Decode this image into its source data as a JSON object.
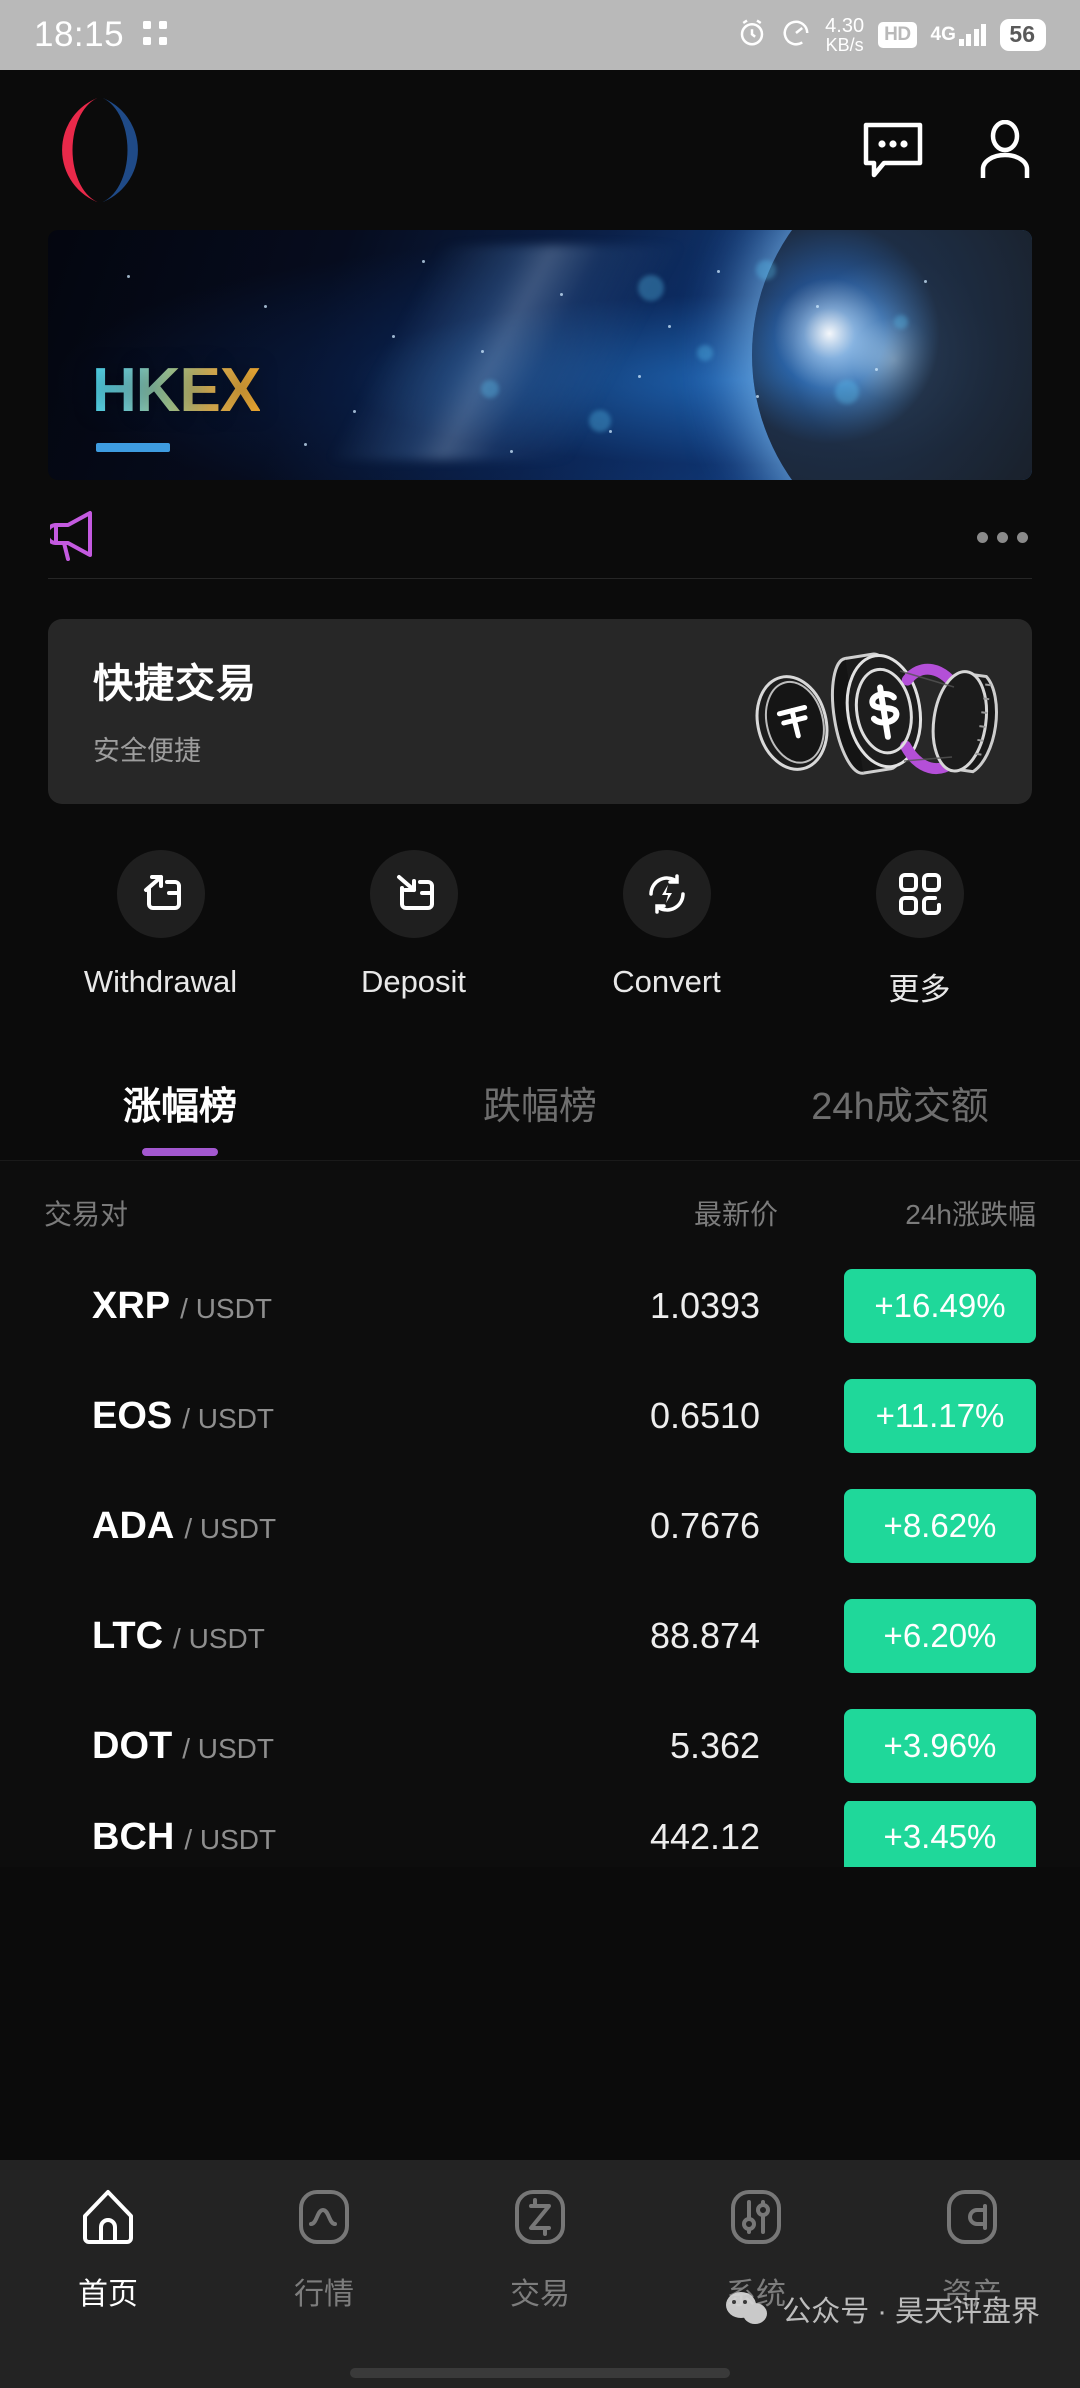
{
  "status_bar": {
    "time": "18:15",
    "network_speed_value": "4.30",
    "network_speed_unit": "KB/s",
    "hd_label": "HD",
    "network_type": "4G",
    "battery": "56",
    "icons": [
      "alarm-clock-icon",
      "speedometer-icon",
      "hd-icon",
      "signal-bars-icon",
      "battery-icon"
    ]
  },
  "header": {
    "logo_name": "hkex-logo",
    "logo_red": "#e9294a",
    "logo_blue": "#1f4a87",
    "chat_icon": "chat-bubble-icon",
    "profile_icon": "person-icon"
  },
  "banner": {
    "title": "HKEX",
    "gradient_start": "#4ad6ef",
    "gradient_end": "#f2a92e",
    "underline_color": "#3e9ce0"
  },
  "announcement": {
    "megaphone_icon": "megaphone-icon",
    "megaphone_color": "#c45ae0",
    "more_icon": "more-dots-icon"
  },
  "quick_trade": {
    "title": "快捷交易",
    "subtitle": "安全便捷",
    "illustration": "three-coins-icon",
    "accent": "#a358d0"
  },
  "actions": [
    {
      "label": "Withdrawal",
      "icon": "withdraw-arrow-out-icon"
    },
    {
      "label": "Deposit",
      "icon": "deposit-arrow-in-icon"
    },
    {
      "label": "Convert",
      "icon": "convert-refresh-icon"
    },
    {
      "label": "更多",
      "icon": "grid-more-icon"
    }
  ],
  "market_tabs": [
    {
      "label": "涨幅榜",
      "active": true
    },
    {
      "label": "跌幅榜",
      "active": false
    },
    {
      "label": "24h成交额",
      "active": false
    }
  ],
  "market_table": {
    "columns": [
      "交易对",
      "最新价",
      "24h涨跌幅"
    ],
    "positive_color": "#1fd89a",
    "rows": [
      {
        "base": "XRP",
        "quote": "/ USDT",
        "price": "1.0393",
        "change": "+16.49%"
      },
      {
        "base": "EOS",
        "quote": "/ USDT",
        "price": "0.6510",
        "change": "+11.17%"
      },
      {
        "base": "ADA",
        "quote": "/ USDT",
        "price": "0.7676",
        "change": "+8.62%"
      },
      {
        "base": "LTC",
        "quote": "/ USDT",
        "price": "88.874",
        "change": "+6.20%"
      },
      {
        "base": "DOT",
        "quote": "/ USDT",
        "price": "5.362",
        "change": "+3.96%"
      },
      {
        "base": "BCH",
        "quote": "/ USDT",
        "price": "442.12",
        "change": "+3.45%"
      }
    ]
  },
  "bottom_nav": [
    {
      "label": "首页",
      "icon": "home-icon",
      "active": true
    },
    {
      "label": "行情",
      "icon": "markets-wave-icon",
      "active": false
    },
    {
      "label": "交易",
      "icon": "trade-z-icon",
      "active": false
    },
    {
      "label": "系统",
      "icon": "system-sliders-icon",
      "active": false
    },
    {
      "label": "资产",
      "icon": "assets-wallet-icon",
      "active": false
    }
  ],
  "watermark": {
    "text": "公众号 · 昊天评盘界",
    "icon": "wechat-icon"
  }
}
